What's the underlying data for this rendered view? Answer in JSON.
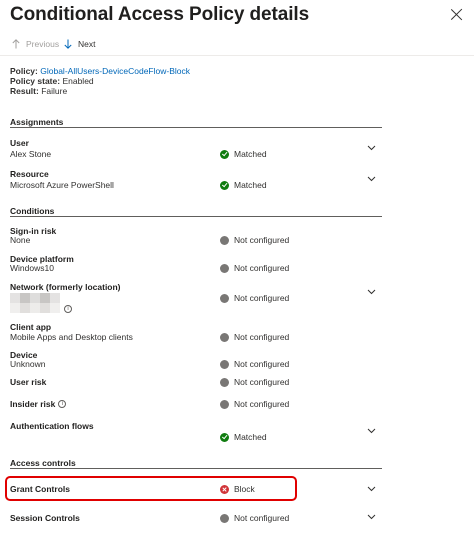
{
  "header": {
    "title": "Conditional Access Policy details",
    "close_icon": "close-icon"
  },
  "toolbar": {
    "previous_label": "Previous",
    "next_label": "Next"
  },
  "policy": {
    "policy_key": "Policy:",
    "policy_value": "Global-AllUsers-DeviceCodeFlow-Block",
    "state_key": "Policy state:",
    "state_value": "Enabled",
    "result_key": "Result:",
    "result_value": "Failure"
  },
  "assignments": {
    "title": "Assignments",
    "user": {
      "label": "User",
      "value": "Alex Stone",
      "status": "Matched"
    },
    "resource": {
      "label": "Resource",
      "value": "Microsoft Azure PowerShell",
      "status": "Matched"
    }
  },
  "conditions": {
    "title": "Conditions",
    "sign_in_risk": {
      "label": "Sign-in risk",
      "value": "None",
      "status": "Not configured"
    },
    "device_platform": {
      "label": "Device platform",
      "value": "Windows10",
      "status": "Not configured"
    },
    "network": {
      "label": "Network (formerly location)",
      "status": "Not configured"
    },
    "client_app": {
      "label": "Client app",
      "value": "Mobile Apps and Desktop clients",
      "status": "Not configured"
    },
    "device": {
      "label": "Device",
      "value": "Unknown",
      "status": "Not configured"
    },
    "user_risk": {
      "label": "User risk",
      "status": "Not configured"
    },
    "insider_risk": {
      "label": "Insider risk",
      "status": "Not configured"
    },
    "auth_flows": {
      "label": "Authentication flows",
      "status": "Matched"
    }
  },
  "access_controls": {
    "title": "Access controls",
    "grant": {
      "label": "Grant Controls",
      "status": "Block"
    },
    "session": {
      "label": "Session Controls",
      "status": "Not configured"
    }
  },
  "colors": {
    "matched": "#107c10",
    "not_configured": "#797775",
    "block": "#d13438",
    "link": "#0067b8",
    "highlight": "#e00000"
  }
}
